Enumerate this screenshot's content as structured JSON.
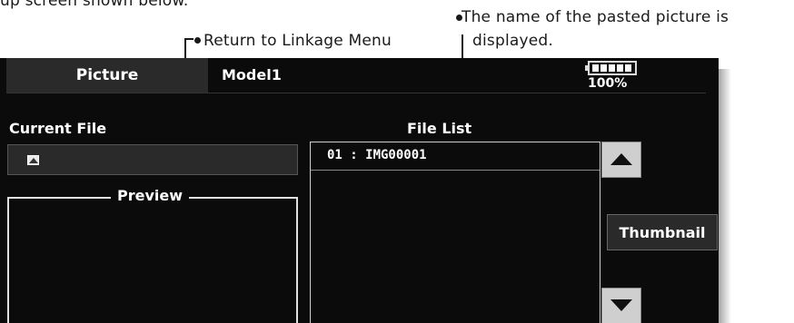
{
  "annotations": {
    "caption_top": "up screen shown below.",
    "pasted_note_line1": "The name of the pasted picture is",
    "pasted_note_line2": "displayed.",
    "return_note": "Return to Linkage Menu"
  },
  "screen": {
    "title_button": "Picture",
    "model_name": "Model1",
    "battery_percent": "100%",
    "battery_level": 1.0,
    "current_file_label": "Current File",
    "current_file_value": "",
    "file_list_label": "File List",
    "preview_label": "Preview",
    "files": [
      "01 : IMG00001"
    ],
    "thumbnail_button": "Thumbnail"
  },
  "icons": {
    "scroll_up": "up-arrow-icon",
    "scroll_down": "down-arrow-icon",
    "battery": "battery-icon",
    "picture": "picture-icon"
  }
}
